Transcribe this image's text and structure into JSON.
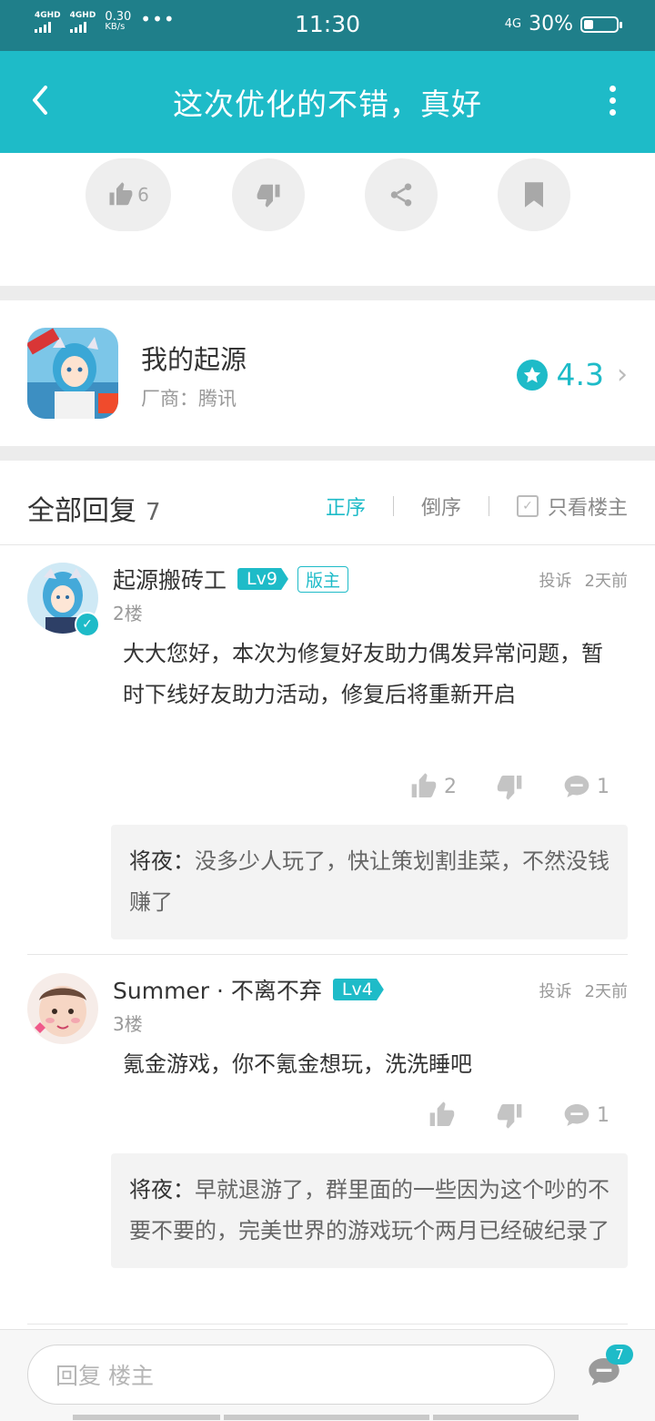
{
  "status_bar": {
    "network_left": "4GHD",
    "network_right": "4GHD",
    "speed_value": "0.30",
    "speed_unit": "KB/s",
    "more": "•••",
    "time": "11:30",
    "network_type": "4G",
    "battery_percent": "30%",
    "battery_level": 0.3
  },
  "header": {
    "title": "这次优化的不错，真好"
  },
  "post_actions": {
    "like_count": "6"
  },
  "game": {
    "name": "我的起源",
    "vendor": "厂商：腾讯",
    "rating": "4.3"
  },
  "replies": {
    "title": "全部回复",
    "count": "7",
    "sort_asc": "正序",
    "sort_desc": "倒序",
    "only_op": "只看楼主",
    "items": [
      {
        "username": "起源搬砖工",
        "level": "Lv9",
        "badge": "版主",
        "floor": "2楼",
        "report": "投诉",
        "time": "2天前",
        "text": "大大您好，本次为修复好友助力偶发异常问题，暂时下线好友助力活动，修复后将重新开启",
        "likes": "2",
        "reply_count": "1",
        "sub_reply": {
          "author": "将夜",
          "sep": "：",
          "text": "没多少人玩了，快让策划割韭菜，不然没钱赚了"
        }
      },
      {
        "username": "Summer · 不离不弃",
        "level": "Lv4",
        "floor": "3楼",
        "report": "投诉",
        "time": "2天前",
        "text": "氪金游戏，你不氪金想玩，洗洗睡吧",
        "reply_count": "1",
        "sub_reply": {
          "author": "将夜",
          "sep": "：",
          "text": "早就退游了，群里面的一些因为这个吵的不要不要的，完美世界的游戏玩个两月已经破纪录了"
        }
      }
    ]
  },
  "bottom_bar": {
    "input_placeholder": "回复  楼主",
    "reply_badge": "7"
  }
}
